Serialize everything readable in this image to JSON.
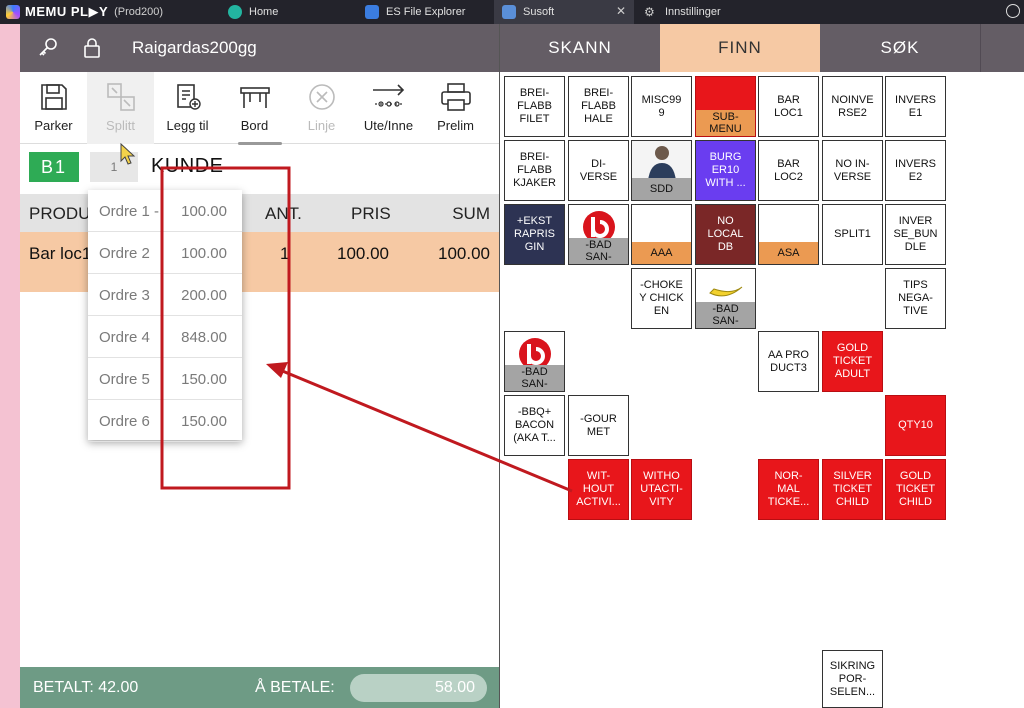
{
  "titlebar": {
    "brand": "MEMU PL▶Y",
    "instance": "(Prod200)",
    "tabs": [
      {
        "label": "Home"
      },
      {
        "label": "ES File Explorer"
      },
      {
        "label": "Susoft"
      },
      {
        "label": "Innstillinger"
      }
    ]
  },
  "left": {
    "user": "Raigardas200gg",
    "toolbar": [
      {
        "label": "Parker"
      },
      {
        "label": "Splitt"
      },
      {
        "label": "Legg til"
      },
      {
        "label": "Bord"
      },
      {
        "label": "Linje"
      },
      {
        "label": "Ute/Inne"
      },
      {
        "label": "Prelim"
      }
    ],
    "table_badge": "B1",
    "order_chip": "1",
    "customer": "KUNDE",
    "columns": {
      "product": "PRODU",
      "qty": "ANT.",
      "price": "PRIS",
      "sum": "SUM"
    },
    "order_line": {
      "product": "Bar loc1",
      "qty": "1",
      "price": "100.00",
      "sum": "100.00"
    },
    "footer": {
      "paid": "BETALT: 42.00",
      "to_pay_label": "Å BETALE:",
      "to_pay_value": "58.00"
    }
  },
  "dropdown": [
    {
      "name": "Ordre 1 -",
      "value": "100.00"
    },
    {
      "name": "Ordre 2",
      "value": "100.00"
    },
    {
      "name": "Ordre 3",
      "value": "200.00"
    },
    {
      "name": "Ordre 4",
      "value": "848.00"
    },
    {
      "name": "Ordre 5",
      "value": "150.00"
    },
    {
      "name": "Ordre 6",
      "value": "150.00"
    }
  ],
  "right": {
    "tabs": [
      {
        "label": "SKANN"
      },
      {
        "label": "FINN"
      },
      {
        "label": "SØK"
      }
    ],
    "tiles": [
      {
        "text": "BREI-\nFLABB\nFILET"
      },
      {
        "text": "BREI-\nFLABB\nHALE"
      },
      {
        "text": "MISC99\n9"
      },
      {
        "text": "SUB-\nMENU"
      },
      {
        "text": "BAR\nLOC1"
      },
      {
        "text": "NOINVE\nRSE2"
      },
      {
        "text": "INVERS\nE1"
      },
      {
        "text": "BREI-\nFLABB\nKJAKER"
      },
      {
        "text": "DI-\nVERSE"
      },
      {
        "text": "SDD"
      },
      {
        "text": "BURG\nER10\nWITH ..."
      },
      {
        "text": "BAR\nLOC2"
      },
      {
        "text": "NO IN-\nVERSE"
      },
      {
        "text": "INVERS\nE2"
      },
      {
        "text": "+EKST\nRAPRIS\nGIN"
      },
      {
        "text": "-BAD\nSAN-"
      },
      {
        "text": "AAA"
      },
      {
        "text": "NO\nLOCAL\nDB"
      },
      {
        "text": "ASA"
      },
      {
        "text": "SPLIT1"
      },
      {
        "text": "INVER\nSE_BUN\nDLE"
      },
      {
        "text": "-CHOKE\nY CHICK\nEN"
      },
      {
        "text": "-BAD\nSAN-"
      },
      {
        "text": "TIPS\nNEGA-\nTIVE"
      },
      {
        "text": "-BAD\nSAN-"
      },
      {
        "text": "AA PRO\nDUCT3"
      },
      {
        "text": "GOLD\nTICKET\nADULT"
      },
      {
        "text": "-BBQ+\nBACON\n(AKA T..."
      },
      {
        "text": "-GOUR\nMET"
      },
      {
        "text": "QTY10"
      },
      {
        "text": "WIT-\nHOUT\nACTIVI..."
      },
      {
        "text": "WITHO\nUTACTI-\nVITY"
      },
      {
        "text": "NOR-\nMAL\nTICKE..."
      },
      {
        "text": "SILVER\nTICKET\nCHILD"
      },
      {
        "text": "GOLD\nTICKET\nCHILD"
      },
      {
        "text": "SIKRING\nPOR-\nSELEN..."
      }
    ]
  },
  "colors": {
    "header": "#645d65",
    "accent_tab": "#f6c9a4",
    "table_green": "#2eab55",
    "tile_red": "#e8161b",
    "annotation": "#c0191f"
  }
}
